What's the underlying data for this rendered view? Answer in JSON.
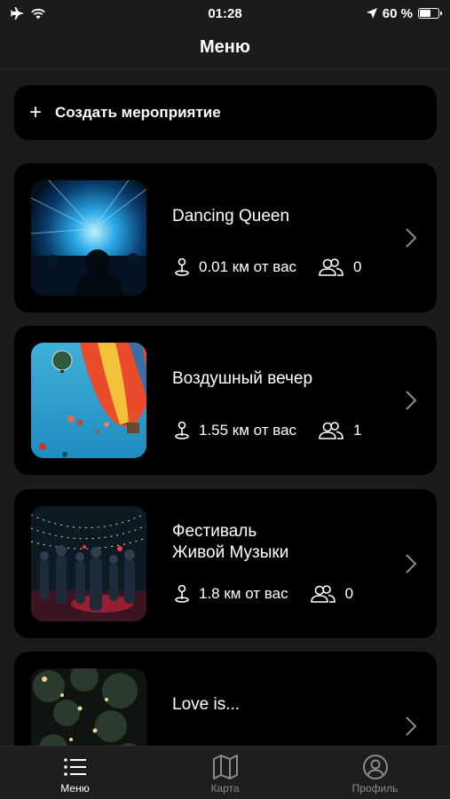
{
  "status_bar": {
    "time": "01:28",
    "battery_percent": "60 %",
    "battery_level": 0.6,
    "icons": [
      "airplane-icon",
      "wifi-icon",
      "location-arrow-icon",
      "battery-icon"
    ]
  },
  "header": {
    "title": "Меню"
  },
  "create_button": {
    "icon": "plus-icon",
    "label": "Создать мероприятие"
  },
  "events": [
    {
      "title": "Dancing Queen",
      "distance": "0.01 км от вас",
      "participants": "0",
      "image": "concert-crowd-blue-lights"
    },
    {
      "title": "Воздушный вечер",
      "distance": "1.55 км от вас",
      "participants": "1",
      "image": "hot-air-balloons"
    },
    {
      "title": "Фестиваль\nЖивой Музыки",
      "distance": "1.8 км от вас",
      "participants": "0",
      "image": "people-under-string-lights"
    },
    {
      "title": "Love is...",
      "distance": "",
      "participants": "",
      "image": "fairy-lights-dark-tree"
    }
  ],
  "tab_bar": {
    "tabs": [
      {
        "label": "Меню",
        "icon": "list-icon",
        "active": true
      },
      {
        "label": "Карта",
        "icon": "map-icon",
        "active": false
      },
      {
        "label": "Профиль",
        "icon": "profile-icon",
        "active": false
      }
    ]
  },
  "colors": {
    "background": "#1b1b1b",
    "card": "#000000",
    "text": "#ffffff",
    "inactive_tab": "#8a8a8a"
  }
}
